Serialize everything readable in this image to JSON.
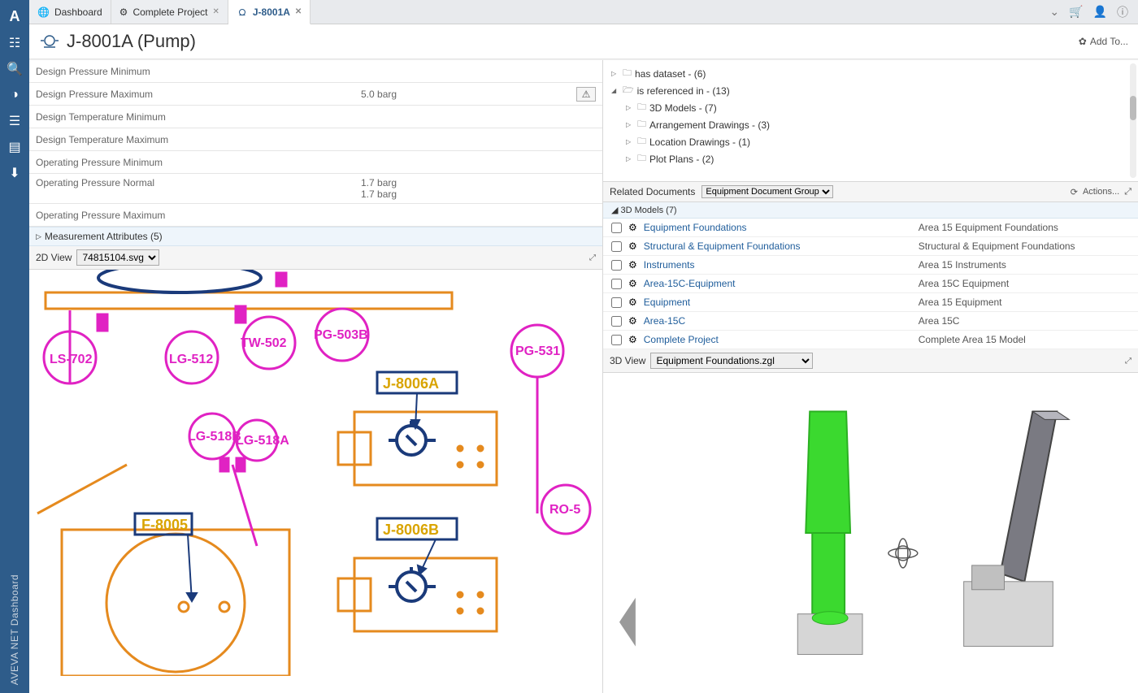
{
  "app": {
    "brand": "A",
    "sidebar_label": "AVEVA NET Dashboard"
  },
  "tabs": [
    {
      "label": "Dashboard"
    },
    {
      "label": "Complete Project"
    },
    {
      "label": "J-8001A"
    }
  ],
  "page": {
    "title": "J-8001A (Pump)",
    "add_to": "Add To..."
  },
  "properties": {
    "rows": [
      {
        "key": "Design Pressure Minimum",
        "val": "",
        "warn": false
      },
      {
        "key": "Design Pressure Maximum",
        "val": "5.0 barg",
        "warn": true
      },
      {
        "key": "Design Temperature Minimum",
        "val": "",
        "warn": false
      },
      {
        "key": "Design Temperature Maximum",
        "val": "",
        "warn": false
      },
      {
        "key": "Operating Pressure Minimum",
        "val": "",
        "warn": false
      },
      {
        "key": "Operating Pressure Normal",
        "val": "1.7 barg",
        "val2": "1.7 barg",
        "warn": false
      },
      {
        "key": "Operating Pressure Maximum",
        "val": "",
        "warn": false
      }
    ],
    "section_label": "Measurement Attributes (5)"
  },
  "view2d": {
    "label": "2D View",
    "file": "74815104.svg"
  },
  "tree": {
    "nodes": [
      {
        "label": "has dataset - (6)",
        "indent": 0,
        "exp": "▷"
      },
      {
        "label": "is referenced in - (13)",
        "indent": 0,
        "exp": "◢"
      },
      {
        "label": "3D Models - (7)",
        "indent": 1,
        "exp": "▷"
      },
      {
        "label": "Arrangement Drawings - (3)",
        "indent": 1,
        "exp": "▷"
      },
      {
        "label": "Location Drawings - (1)",
        "indent": 1,
        "exp": "▷"
      },
      {
        "label": "Plot Plans - (2)",
        "indent": 1,
        "exp": "▷"
      }
    ]
  },
  "related": {
    "title": "Related Documents",
    "group": "Equipment Document Group",
    "actions": "Actions...",
    "subheader": "3D Models (7)",
    "docs": [
      {
        "name": "Equipment Foundations",
        "desc": "Area 15 Equipment Foundations"
      },
      {
        "name": "Structural & Equipment Foundations",
        "desc": "Structural & Equipment Foundations"
      },
      {
        "name": "Instruments",
        "desc": "Area 15 Instruments"
      },
      {
        "name": "Area-15C-Equipment",
        "desc": "Area 15C Equipment"
      },
      {
        "name": "Equipment",
        "desc": "Area 15 Equipment"
      },
      {
        "name": "Area-15C",
        "desc": "Area 15C"
      },
      {
        "name": "Complete Project",
        "desc": "Complete Area 15 Model"
      }
    ]
  },
  "view3d": {
    "label": "3D View",
    "file": "Equipment Foundations.zgl"
  },
  "drawing": {
    "ls702": "LS-702",
    "lg512": "LG-512",
    "tw502": "TW-502",
    "pg503b": "PG-503B",
    "pg531": "PG-531",
    "lg518b": "LG-518B",
    "lg518a": "LG-518A",
    "j8006a": "J-8006A",
    "j8006b": "J-8006B",
    "f8005": "F-8005",
    "ro5": "RO-5"
  }
}
